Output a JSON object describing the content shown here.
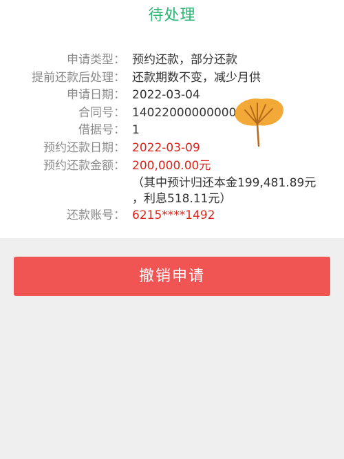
{
  "header": {
    "status_label": "待处理"
  },
  "details": {
    "rows": [
      {
        "label": "申请类型：",
        "value": "预约还款，部分还款"
      },
      {
        "label": "提前还款后处理：",
        "value": "还款期数不变，减少月供"
      },
      {
        "label": "申请日期：",
        "value": "2022-03-04"
      },
      {
        "label": "合同号：",
        "value": "14022000000000"
      },
      {
        "label": "借据号：",
        "value": "1"
      },
      {
        "label": "预约还款日期：",
        "value": "2022-03-09"
      },
      {
        "label": "预约还款金额：",
        "value": "200,000.00元"
      },
      {
        "label": "还款账号：",
        "value": "6215****1492"
      }
    ],
    "amount_note_line1": "（其中预计归还本金199,481.89元",
    "amount_note_line2": "，利息518.11元）"
  },
  "actions": {
    "cancel_label": "撤销申请"
  },
  "colors": {
    "status_green": "#2bb673",
    "highlight_red": "#d9261c",
    "button_red": "#f15553",
    "sticker_orange": "#f3a938"
  },
  "icons": {
    "sticker": "ginkgo-leaf-icon"
  }
}
